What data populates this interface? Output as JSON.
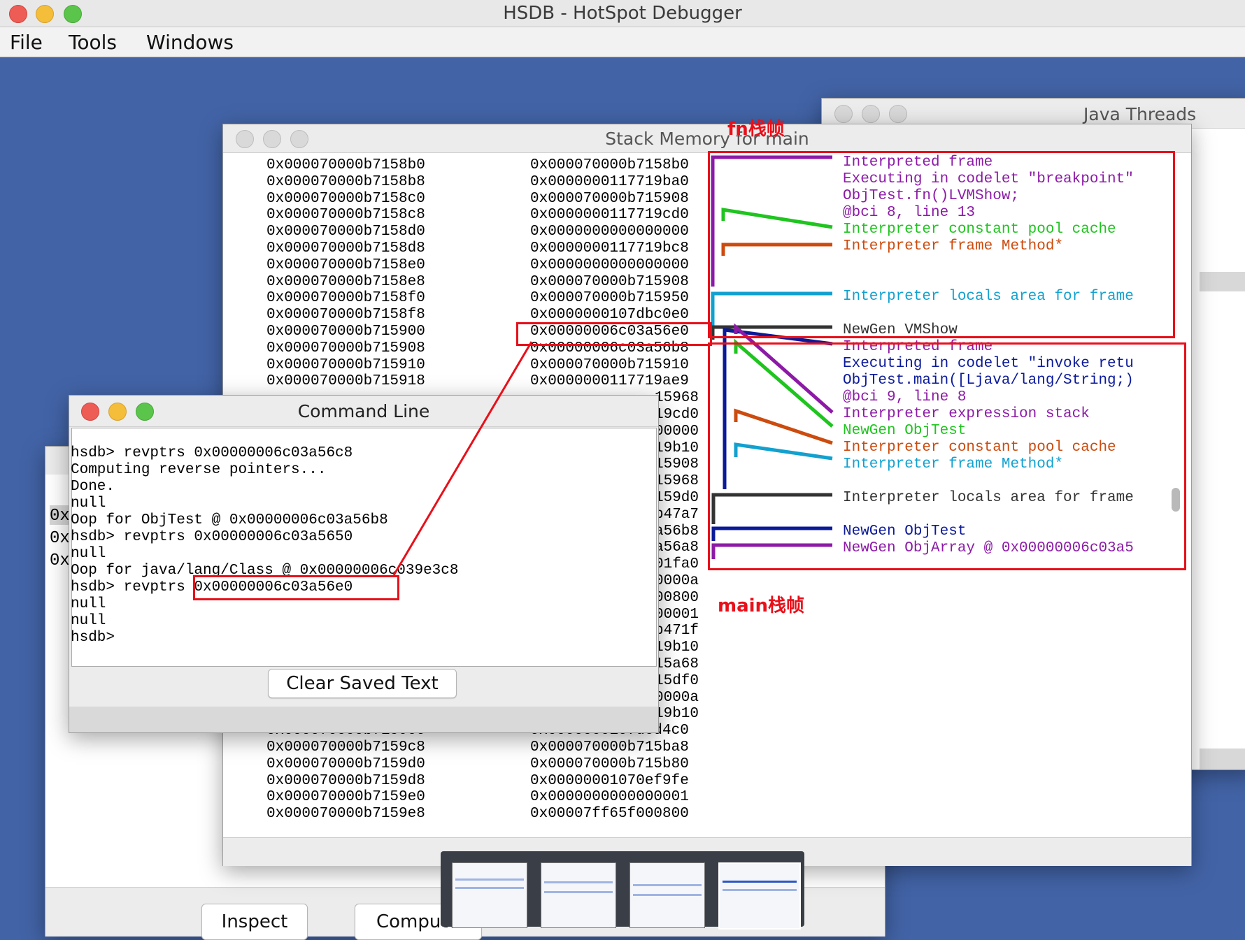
{
  "app": {
    "title": "HSDB - HotSpot Debugger"
  },
  "menu": [
    "File",
    "Tools",
    "Windows"
  ],
  "java_threads": {
    "title": "Java Threads"
  },
  "stack_memory": {
    "title": "Stack Memory for main",
    "rows_top": [
      {
        "addr": "0x000070000b7158b0",
        "val": "0x000070000b7158b0"
      },
      {
        "addr": "0x000070000b7158b8",
        "val": "0x0000000117719ba0"
      },
      {
        "addr": "0x000070000b7158c0",
        "val": "0x000070000b715908"
      },
      {
        "addr": "0x000070000b7158c8",
        "val": "0x0000000117719cd0"
      },
      {
        "addr": "0x000070000b7158d0",
        "val": "0x0000000000000000"
      },
      {
        "addr": "0x000070000b7158d8",
        "val": "0x0000000117719bc8"
      },
      {
        "addr": "0x000070000b7158e0",
        "val": "0x0000000000000000"
      },
      {
        "addr": "0x000070000b7158e8",
        "val": "0x000070000b715908"
      },
      {
        "addr": "0x000070000b7158f0",
        "val": "0x000070000b715950"
      },
      {
        "addr": "0x000070000b7158f8",
        "val": "0x0000000107dbc0e0"
      },
      {
        "addr": "0x000070000b715900",
        "val": "0x00000006c03a56e0"
      },
      {
        "addr": "0x000070000b715908",
        "val": "0x00000006c03a56b8"
      },
      {
        "addr": "0x000070000b715910",
        "val": "0x000070000b715910"
      },
      {
        "addr": "0x000070000b715918",
        "val": "0x0000000117719ae9"
      }
    ],
    "partial_vals": [
      "15968",
      "19cd0",
      "00000",
      "19b10",
      "15908",
      "15968",
      "159d0",
      "b47a7",
      "a56b8",
      "a56a8",
      "01fa0",
      "0000a",
      "00800",
      "00001",
      "b471f",
      "19b10",
      "15a68",
      "15df0",
      "0000a",
      "19b10"
    ],
    "rows_bottom": [
      {
        "addr": "0x000070000b7159c0",
        "val": "0x0000000107dcd4c0"
      },
      {
        "addr": "0x000070000b7159c8",
        "val": "0x000070000b715ba8"
      },
      {
        "addr": "0x000070000b7159d0",
        "val": "0x000070000b715b80"
      },
      {
        "addr": "0x000070000b7159d8",
        "val": "0x00000001070ef9fe"
      },
      {
        "addr": "0x000070000b7159e0",
        "val": "0x0000000000000001"
      },
      {
        "addr": "0x000070000b7159e8",
        "val": "0x00007ff65f000800"
      }
    ],
    "frame_annotations": [
      {
        "text": "Interpreted frame",
        "color": "#8c1aa6"
      },
      {
        "text": "Executing in codelet \"breakpoint\"",
        "color": "#8c1aa6"
      },
      {
        "text": "ObjTest.fn()LVMShow;",
        "color": "#8c1aa6"
      },
      {
        "text": "@bci 8, line 13",
        "color": "#8c1aa6"
      },
      {
        "text": "Interpreter constant pool cache",
        "color": "#1fc41f"
      },
      {
        "text": "Interpreter frame Method*",
        "color": "#cc4b0e"
      },
      {
        "text": "Interpreter locals area for frame",
        "color": "#12a1cf"
      },
      {
        "text": "NewGen VMShow",
        "color": "#333333"
      },
      {
        "text": "Interpreted frame",
        "color": "#8c1aa6"
      },
      {
        "text": "Executing in codelet \"invoke retu",
        "color": "#0b1a99"
      },
      {
        "text": "ObjTest.main([Ljava/lang/String;)",
        "color": "#0b1a99"
      },
      {
        "text": "@bci 9, line 8",
        "color": "#8c1aa6"
      },
      {
        "text": "Interpreter expression stack",
        "color": "#8c1aa6"
      },
      {
        "text": "NewGen ObjTest",
        "color": "#1fc41f"
      },
      {
        "text": "Interpreter constant pool cache",
        "color": "#cc4b0e"
      },
      {
        "text": "Interpreter frame Method*",
        "color": "#12a1cf"
      },
      {
        "text": "Interpreter locals area for frame",
        "color": "#333333"
      },
      {
        "text": "NewGen ObjTest",
        "color": "#0b1a99"
      },
      {
        "text": "NewGen ObjArray @ 0x00000006c03a5",
        "color": "#8c1aa6"
      }
    ]
  },
  "annotations": {
    "fn_frame": "fn栈帧",
    "main_frame": "main栈帧"
  },
  "command_line": {
    "title": "Command Line",
    "lines": [
      "hsdb> revptrs 0x00000006c03a56c8",
      "Computing reverse pointers...",
      "Done.",
      "null",
      "Oop for ObjTest @ 0x00000006c03a56b8",
      "hsdb> revptrs 0x00000006c03a5650",
      "null",
      "Oop for java/lang/Class @ 0x00000006c039e3c8",
      "hsdb> revptrs 0x00000006c03a56e0",
      "null",
      "null",
      "hsdb>"
    ],
    "clear_button": "Clear Saved Text"
  },
  "behind_window": {
    "row_prefixes": [
      "0x",
      "0x",
      "0x"
    ]
  },
  "bottom_buttons": {
    "inspect": "Inspect",
    "compute": "Compute",
    "compute_tail": "s"
  },
  "colors": {
    "desktop": "#4263a6",
    "highlight": "#e8101a"
  }
}
